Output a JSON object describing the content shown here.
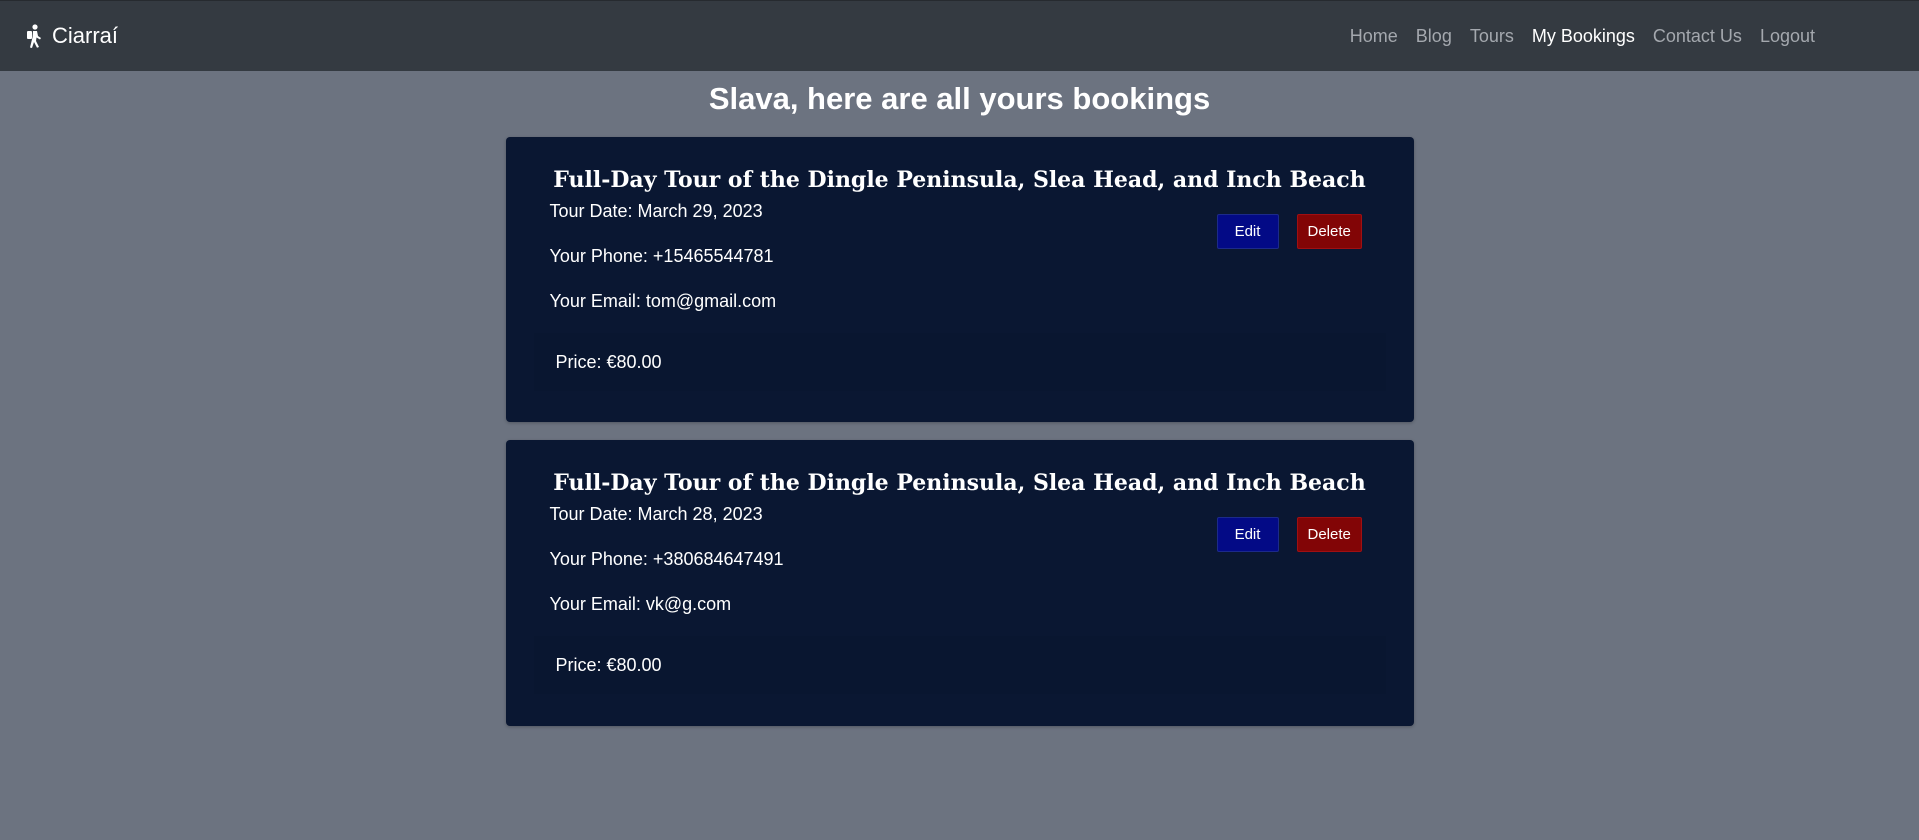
{
  "navbar": {
    "brand": "Ciarraí",
    "brand_icon": "hiker-icon",
    "links": [
      {
        "label": "Home",
        "active": false
      },
      {
        "label": "Blog",
        "active": false
      },
      {
        "label": "Tours",
        "active": false
      },
      {
        "label": "My Bookings",
        "active": true
      },
      {
        "label": "Contact Us",
        "active": false
      },
      {
        "label": "Logout",
        "active": false
      }
    ]
  },
  "page": {
    "title": "Slava, here are all yours bookings"
  },
  "bookings": [
    {
      "tour_title": "Full-Day Tour of the Dingle Peninsula, Slea Head, and Inch Beach",
      "tour_date": "Tour Date: March 29, 2023",
      "phone": "Your Phone: +15465544781",
      "email": "Your Email: tom@gmail.com",
      "price": "Price: €80.00",
      "edit_label": "Edit",
      "delete_label": "Delete"
    },
    {
      "tour_title": "Full-Day Tour of the Dingle Peninsula, Slea Head, and Inch Beach",
      "tour_date": "Tour Date: March 28, 2023",
      "phone": "Your Phone: +380684647491",
      "email": "Your Email: vk@g.com",
      "price": "Price: €80.00",
      "edit_label": "Edit",
      "delete_label": "Delete"
    }
  ],
  "colors": {
    "background": "#6c7380",
    "navbar": "#343a41",
    "card": "#0a1732",
    "edit_button": "#030a86",
    "delete_button": "#820506"
  }
}
